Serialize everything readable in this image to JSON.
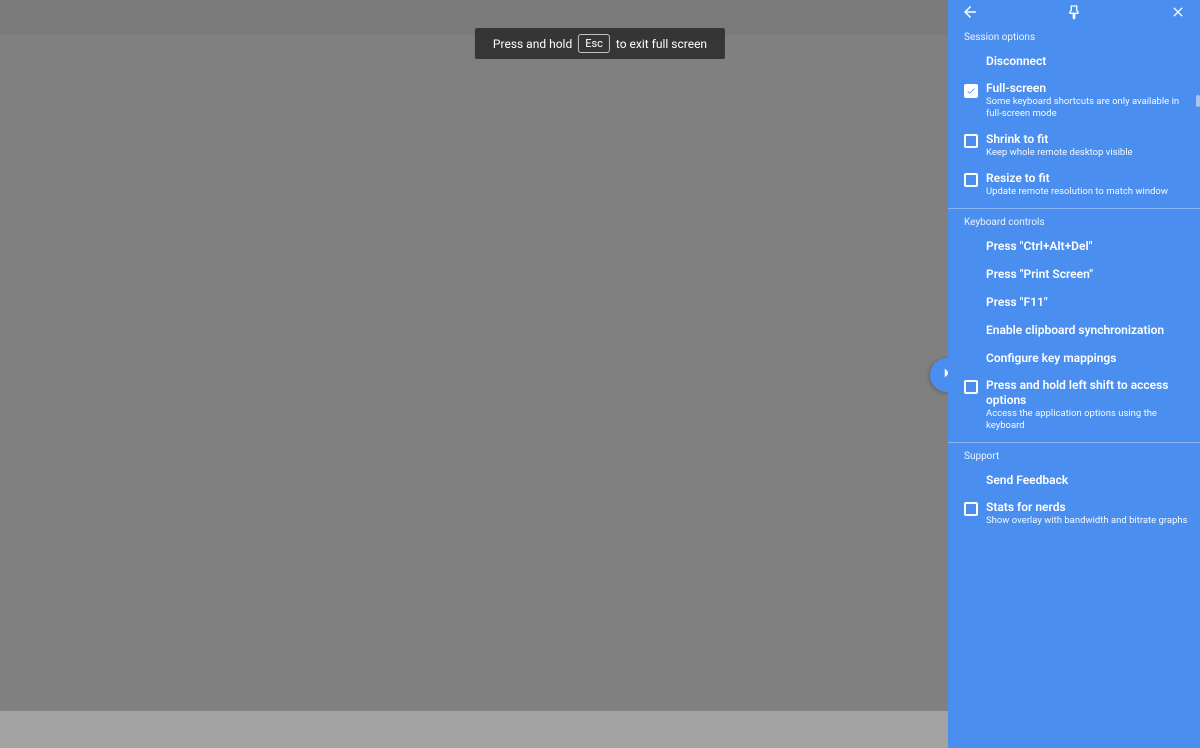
{
  "toast": {
    "pre": "Press and hold",
    "key": "Esc",
    "post": "to exit full screen"
  },
  "panel": {
    "sections": {
      "session": {
        "title": "Session options",
        "disconnect": "Disconnect",
        "fullscreen": {
          "label": "Full-screen",
          "sub": "Some keyboard shortcuts are only available in full-screen mode",
          "checked": true
        },
        "shrink": {
          "label": "Shrink to fit",
          "sub": "Keep whole remote desktop visible",
          "checked": false
        },
        "resize": {
          "label": "Resize to fit",
          "sub": "Update remote resolution to match window",
          "checked": false
        }
      },
      "keyboard": {
        "title": "Keyboard controls",
        "cad": "Press \"Ctrl+Alt+Del\"",
        "prtsc": "Press \"Print Screen\"",
        "f11": "Press \"F11\"",
        "clip": "Enable clipboard synchronization",
        "keymap": "Configure key mappings",
        "shift": {
          "label": "Press and hold left shift to access options",
          "sub": "Access the application options using the keyboard",
          "checked": false
        }
      },
      "support": {
        "title": "Support",
        "feedback": "Send Feedback",
        "stats": {
          "label": "Stats for nerds",
          "sub": "Show overlay with bandwidth and bitrate graphs",
          "checked": false
        }
      }
    }
  }
}
